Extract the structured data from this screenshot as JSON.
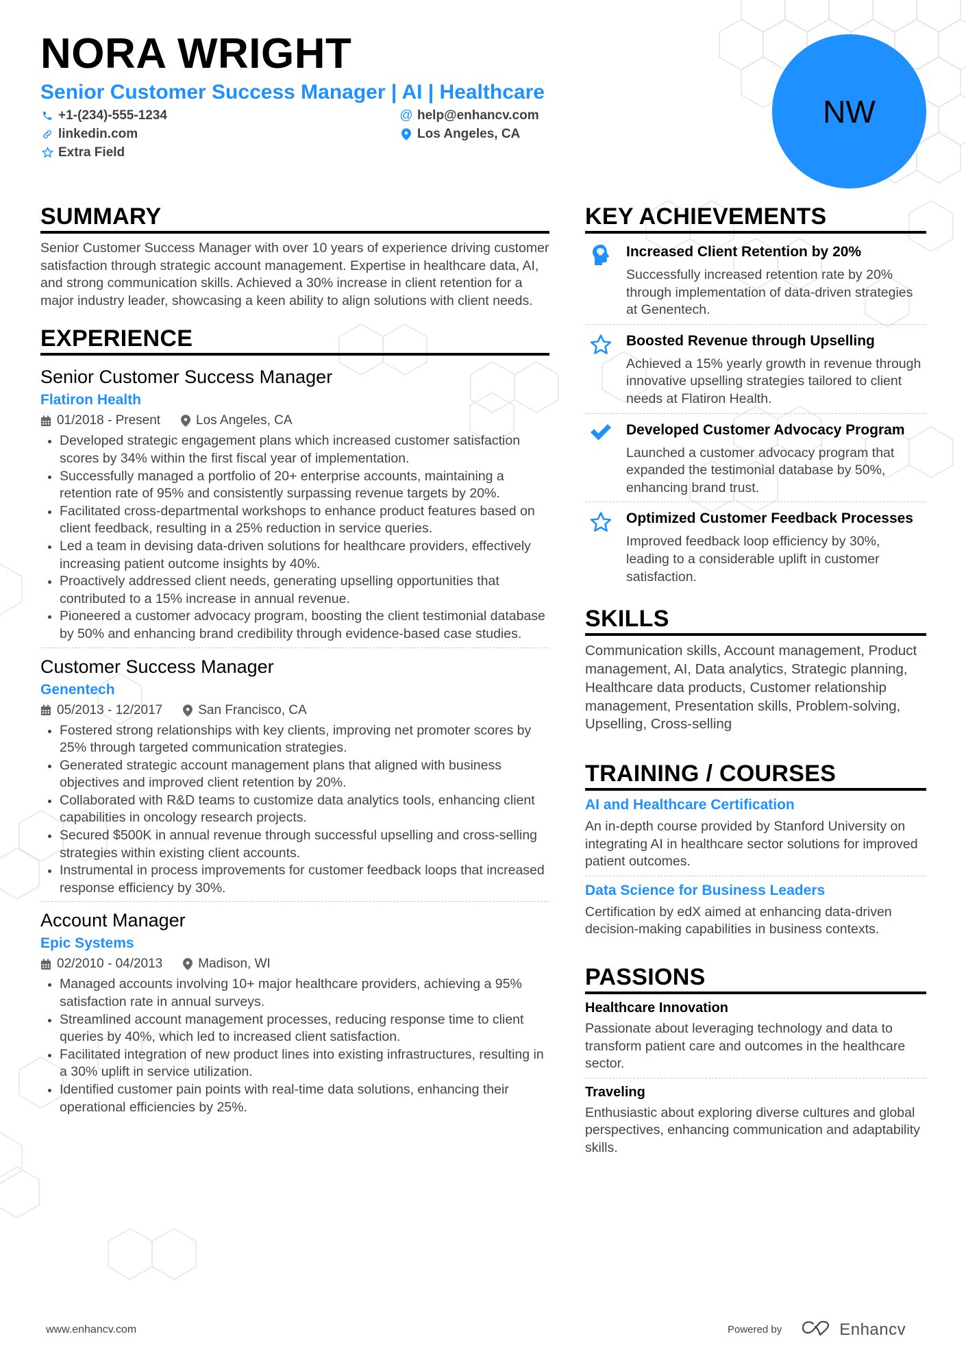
{
  "header": {
    "name": "NORA WRIGHT",
    "subtitle": "Senior Customer Success Manager | AI | Healthcare",
    "initials": "NW",
    "contacts": {
      "phone": "+1-(234)-555-1234",
      "email": "help@enhancv.com",
      "linkedin": "linkedin.com",
      "location": "Los Angeles, CA",
      "extra": "Extra Field"
    }
  },
  "summary": {
    "title": "SUMMARY",
    "text": "Senior Customer Success Manager with over 10 years of experience driving customer satisfaction through strategic account management. Expertise in healthcare data, AI, and strong communication skills. Achieved a 30% increase in client retention for a major industry leader, showcasing a keen ability to align solutions with client needs."
  },
  "experience": {
    "title": "EXPERIENCE",
    "jobs": [
      {
        "title": "Senior Customer Success Manager",
        "company": "Flatiron Health",
        "dates": "01/2018 - Present",
        "location": "Los Angeles, CA",
        "bullets": [
          "Developed strategic engagement plans which increased customer satisfaction scores by 34% within the first fiscal year of implementation.",
          "Successfully managed a portfolio of 20+ enterprise accounts, maintaining a retention rate of 95% and consistently surpassing revenue targets by 20%.",
          "Facilitated cross-departmental workshops to enhance product features based on client feedback, resulting in a 25% reduction in service queries.",
          "Led a team in devising data-driven solutions for healthcare providers, effectively increasing patient outcome insights by 40%.",
          "Proactively addressed client needs, generating upselling opportunities that contributed to a 15% increase in annual revenue.",
          "Pioneered a customer advocacy program, boosting the client testimonial database by 50% and enhancing brand credibility through evidence-based case studies."
        ]
      },
      {
        "title": "Customer Success Manager",
        "company": "Genentech",
        "dates": "05/2013 - 12/2017",
        "location": "San Francisco, CA",
        "bullets": [
          "Fostered strong relationships with key clients, improving net promoter scores by 25% through targeted communication strategies.",
          "Generated strategic account management plans that aligned with business objectives and improved client retention by 20%.",
          "Collaborated with R&D teams to customize data analytics tools, enhancing client capabilities in oncology research projects.",
          "Secured $500K in annual revenue through successful upselling and cross-selling strategies within existing client accounts.",
          "Instrumental in process improvements for customer feedback loops that increased response efficiency by 30%."
        ]
      },
      {
        "title": "Account Manager",
        "company": "Epic Systems",
        "dates": "02/2010 - 04/2013",
        "location": "Madison, WI",
        "bullets": [
          "Managed accounts involving 10+ major healthcare providers, achieving a 95% satisfaction rate in annual surveys.",
          "Streamlined account management processes, reducing response time to client queries by 40%, which led to increased client satisfaction.",
          "Facilitated integration of new product lines into existing infrastructures, resulting in a 30% uplift in service utilization.",
          "Identified customer pain points with real-time data solutions, enhancing their operational efficiencies by 25%."
        ]
      }
    ]
  },
  "achievements": {
    "title": "KEY ACHIEVEMENTS",
    "items": [
      {
        "icon": "head-icon",
        "title": "Increased Client Retention by 20%",
        "desc": "Successfully increased retention rate by 20% through implementation of data-driven strategies at Genentech."
      },
      {
        "icon": "star-icon",
        "title": "Boosted Revenue through Upselling",
        "desc": "Achieved a 15% yearly growth in revenue through innovative upselling strategies tailored to client needs at Flatiron Health."
      },
      {
        "icon": "check-icon",
        "title": "Developed Customer Advocacy Program",
        "desc": "Launched a customer advocacy program that expanded the testimonial database by 50%, enhancing brand trust."
      },
      {
        "icon": "star-icon",
        "title": "Optimized Customer Feedback Processes",
        "desc": "Improved feedback loop efficiency by 30%, leading to a considerable uplift in customer satisfaction."
      }
    ]
  },
  "skills": {
    "title": "SKILLS",
    "text": "Communication skills, Account management, Product management, AI, Data analytics, Strategic planning, Healthcare data products, Customer relationship management, Presentation skills, Problem-solving, Upselling, Cross-selling"
  },
  "training": {
    "title": "TRAINING / COURSES",
    "items": [
      {
        "title": "AI and Healthcare Certification",
        "desc": "An in-depth course provided by Stanford University on integrating AI in healthcare sector solutions for improved patient outcomes."
      },
      {
        "title": "Data Science for Business Leaders",
        "desc": "Certification by edX aimed at enhancing data-driven decision-making capabilities in business contexts."
      }
    ]
  },
  "passions": {
    "title": "PASSIONS",
    "items": [
      {
        "title": "Healthcare Innovation",
        "desc": "Passionate about leveraging technology and data to transform patient care and outcomes in the healthcare sector."
      },
      {
        "title": "Traveling",
        "desc": "Enthusiastic about exploring diverse cultures and global perspectives, enhancing communication and adaptability skills."
      }
    ]
  },
  "footer": {
    "website": "www.enhancv.com",
    "powered_by": "Powered by",
    "brand": "Enhancv"
  },
  "colors": {
    "accent": "#1e90ff",
    "text": "#3d444a",
    "heading": "#000000",
    "hex_pattern": "#e4e4e4"
  }
}
